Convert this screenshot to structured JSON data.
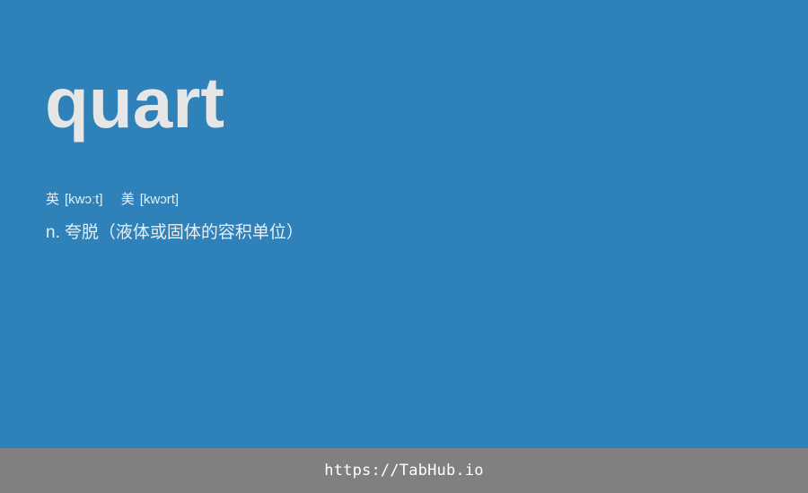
{
  "card": {
    "word": "quart",
    "phonetics": [
      {
        "label": "英",
        "ipa": "[kwɔːt]"
      },
      {
        "label": "美",
        "ipa": "[kwɔrt]"
      }
    ],
    "definition": {
      "pos": "n.",
      "text": "夸脱（液体或固体的容积单位）"
    }
  },
  "footer": {
    "link_text": "https://TabHub.io"
  },
  "colors": {
    "background": "#2f81b9",
    "word": "#e6e6e6",
    "footer_background": "#808080",
    "footer_text": "#ffffff"
  }
}
